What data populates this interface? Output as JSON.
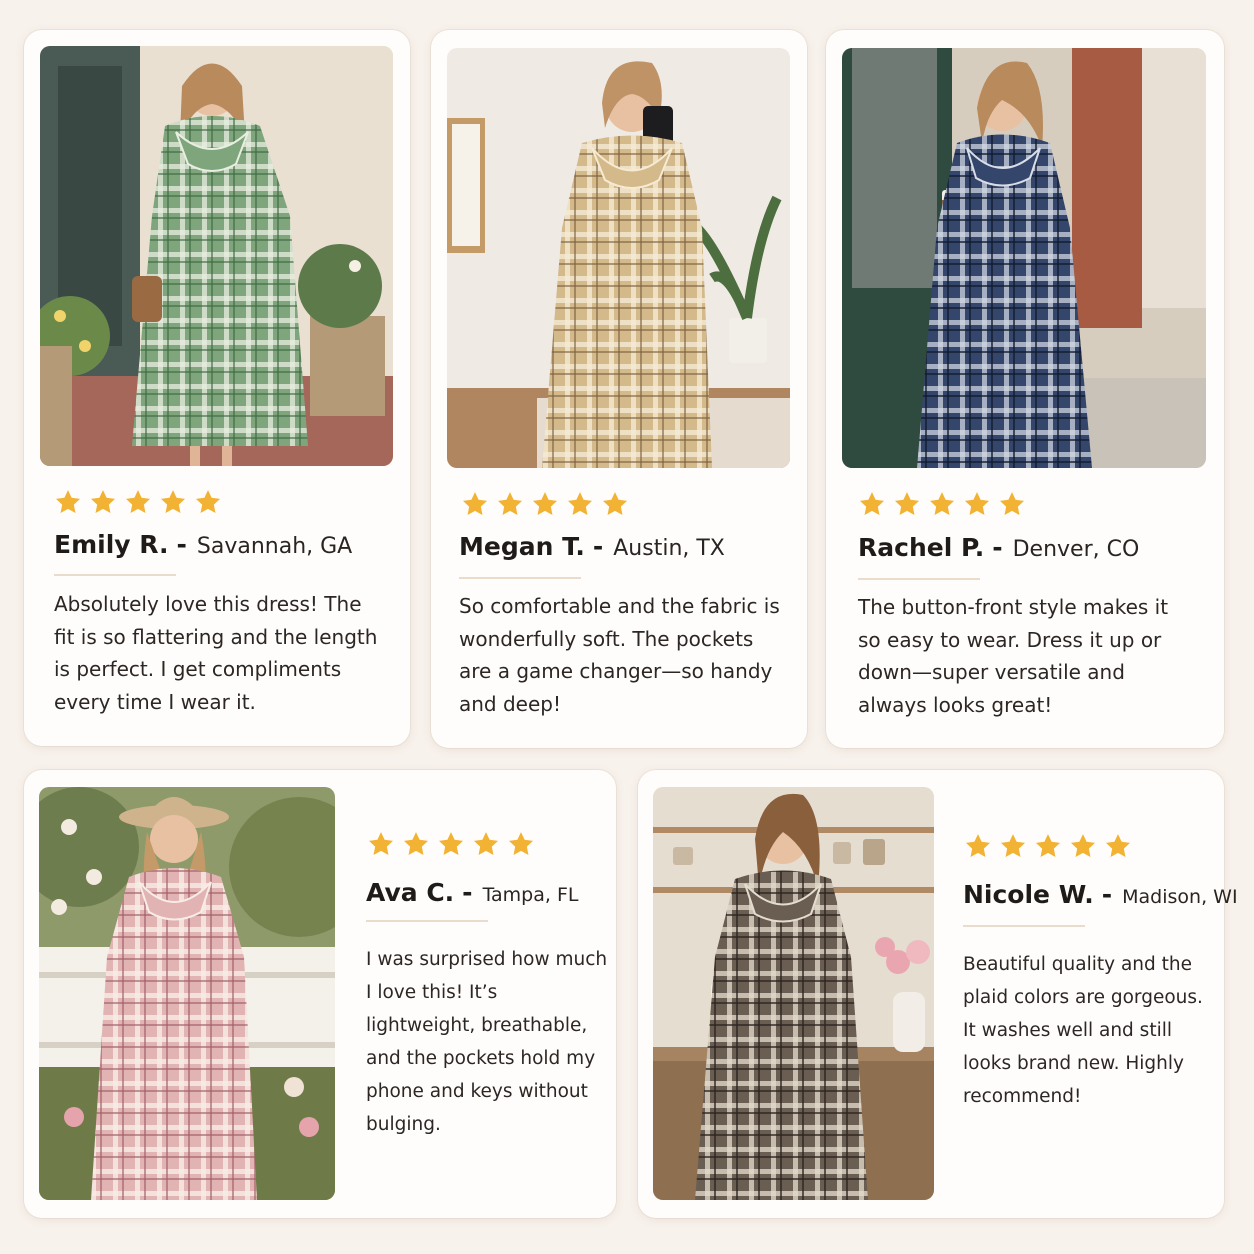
{
  "theme": {
    "star_color": "#f2b233",
    "background": "#f8f2ec"
  },
  "reviews": [
    {
      "name": "Emily R.",
      "separator": "-",
      "location": "Savannah, GA",
      "rating": 5,
      "text": "Absolutely love this dress! The fit is so flattering and the length is perfect. I get compliments every time I wear it.",
      "dress_color": "#6f9a6e"
    },
    {
      "name": "Megan T.",
      "separator": "-",
      "location": "Austin, TX",
      "rating": 5,
      "text": "So comfortable and the fabric is wonderfully soft. The pockets are a game changer—so handy and deep!",
      "dress_color": "#c8ab78"
    },
    {
      "name": "Rachel P.",
      "separator": "-",
      "location": "Denver, CO",
      "rating": 5,
      "text": "The button-front style makes it so easy to wear. Dress it up or down—super versatile and always looks great!",
      "dress_color": "#2e3d5e"
    },
    {
      "name": "Ava C.",
      "separator": "-",
      "location": "Tampa, FL",
      "rating": 5,
      "text": "I was surprised how much I love this! It’s lightweight, breathable, and the pockets hold my phone and keys without bulging.",
      "dress_color": "#d59aa2"
    },
    {
      "name": "Nicole W.",
      "separator": "-",
      "location": "Madison, WI",
      "rating": 5,
      "text": "Beautiful quality and the plaid colors are gorgeous. It washes well and still looks brand new. Highly recommend!",
      "dress_color": "#5a5048"
    }
  ]
}
